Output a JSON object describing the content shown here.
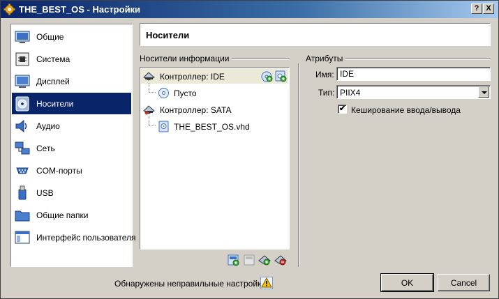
{
  "window": {
    "title": "THE_BEST_OS - Настройки",
    "help_label": "?",
    "close_label": "X"
  },
  "sidebar": {
    "items": [
      {
        "label": "Общие",
        "icon": "general-icon"
      },
      {
        "label": "Система",
        "icon": "system-icon"
      },
      {
        "label": "Дисплей",
        "icon": "display-icon"
      },
      {
        "label": "Носители",
        "icon": "storage-icon",
        "selected": true
      },
      {
        "label": "Аудио",
        "icon": "audio-icon"
      },
      {
        "label": "Сеть",
        "icon": "network-icon"
      },
      {
        "label": "COM-порты",
        "icon": "serial-ports-icon"
      },
      {
        "label": "USB",
        "icon": "usb-icon"
      },
      {
        "label": "Общие папки",
        "icon": "shared-folders-icon"
      },
      {
        "label": "Интерфейс пользователя",
        "icon": "user-interface-icon"
      }
    ]
  },
  "page": {
    "title": "Носители"
  },
  "storage": {
    "group_label": "Носители информации",
    "tree": [
      {
        "label": "Контроллер: IDE",
        "icon": "ide-controller-icon"
      },
      {
        "label": "Пусто",
        "icon": "optical-disc-icon"
      },
      {
        "label": "Контроллер: SATA",
        "icon": "sata-controller-icon"
      },
      {
        "label": "THE_BEST_OS.vhd",
        "icon": "hard-disk-icon"
      }
    ]
  },
  "attributes": {
    "group_label": "Атрибуты",
    "name_label": "Имя:",
    "name_value": "IDE",
    "type_label": "Тип:",
    "type_value": "PIIX4",
    "cache_label": "Кеширование ввода/вывода",
    "cache_checked": true
  },
  "footer": {
    "warning": "Обнаружены неправильные настройки",
    "ok_label": "OK",
    "cancel_label": "Cancel"
  },
  "colors": {
    "selection": "#0a246a",
    "window_bg": "#d4d0c8"
  }
}
